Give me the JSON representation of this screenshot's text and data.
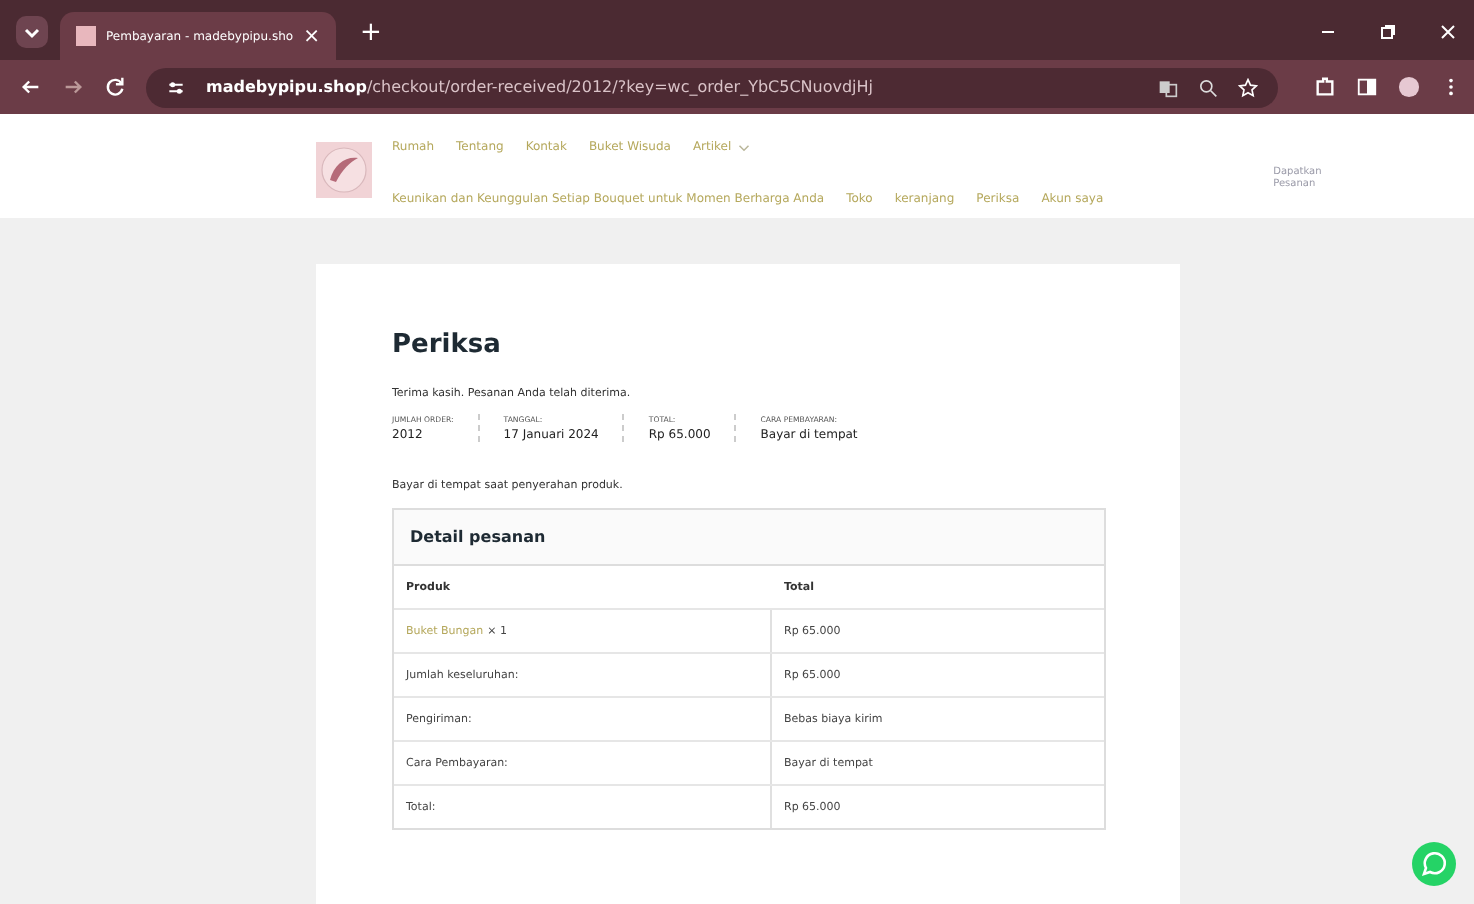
{
  "browser": {
    "tab": {
      "title": "Pembayaran - madebypipu.sho",
      "close": "×"
    },
    "new_tab": "+",
    "url": {
      "domain": "madebypipu.shop",
      "path": "/checkout/order-received/2012/?key=wc_order_YbC5CNuovdjHj"
    }
  },
  "site": {
    "primary_nav": [
      {
        "label": "Rumah",
        "has_dropdown": false
      },
      {
        "label": "Tentang",
        "has_dropdown": false
      },
      {
        "label": "Kontak",
        "has_dropdown": false
      },
      {
        "label": "Buket Wisuda",
        "has_dropdown": false
      },
      {
        "label": "Artikel",
        "has_dropdown": true
      }
    ],
    "secondary_nav": [
      "Keunikan dan Keunggulan Setiap Bouquet untuk Momen Berharga Anda",
      "Toko",
      "keranjang",
      "Periksa",
      "Akun saya"
    ],
    "header_note": [
      "Dapatkan",
      "Pesanan"
    ]
  },
  "order": {
    "title": "Periksa",
    "message": "Terima kasih. Pesanan Anda telah diterima.",
    "summary": [
      {
        "label": "JUMLAH ORDER:",
        "value": "2012"
      },
      {
        "label": "TANGGAL:",
        "value": "17 Januari 2024"
      },
      {
        "label": "TOTAL:",
        "value": "Rp 65.000"
      },
      {
        "label": "CARA PEMBAYARAN:",
        "value": "Bayar di tempat"
      }
    ],
    "payment_note": "Bayar di tempat saat penyerahan produk.",
    "details": {
      "title": "Detail pesanan",
      "columns": [
        "Produk",
        "Total"
      ],
      "rows": [
        {
          "kind": "product",
          "label": "Buket Bungan",
          "quantity": "× 1",
          "value": "Rp 65.000"
        },
        {
          "kind": "plain",
          "label": "Jumlah keseluruhan:",
          "value": "Rp 65.000"
        },
        {
          "kind": "plain",
          "label": "Pengiriman:",
          "value": "Bebas biaya kirim"
        },
        {
          "kind": "plain",
          "label": "Cara Pembayaran:",
          "value": "Bayar di tempat"
        },
        {
          "kind": "plain",
          "label": "Total:",
          "value": "Rp 65.000"
        }
      ]
    }
  }
}
